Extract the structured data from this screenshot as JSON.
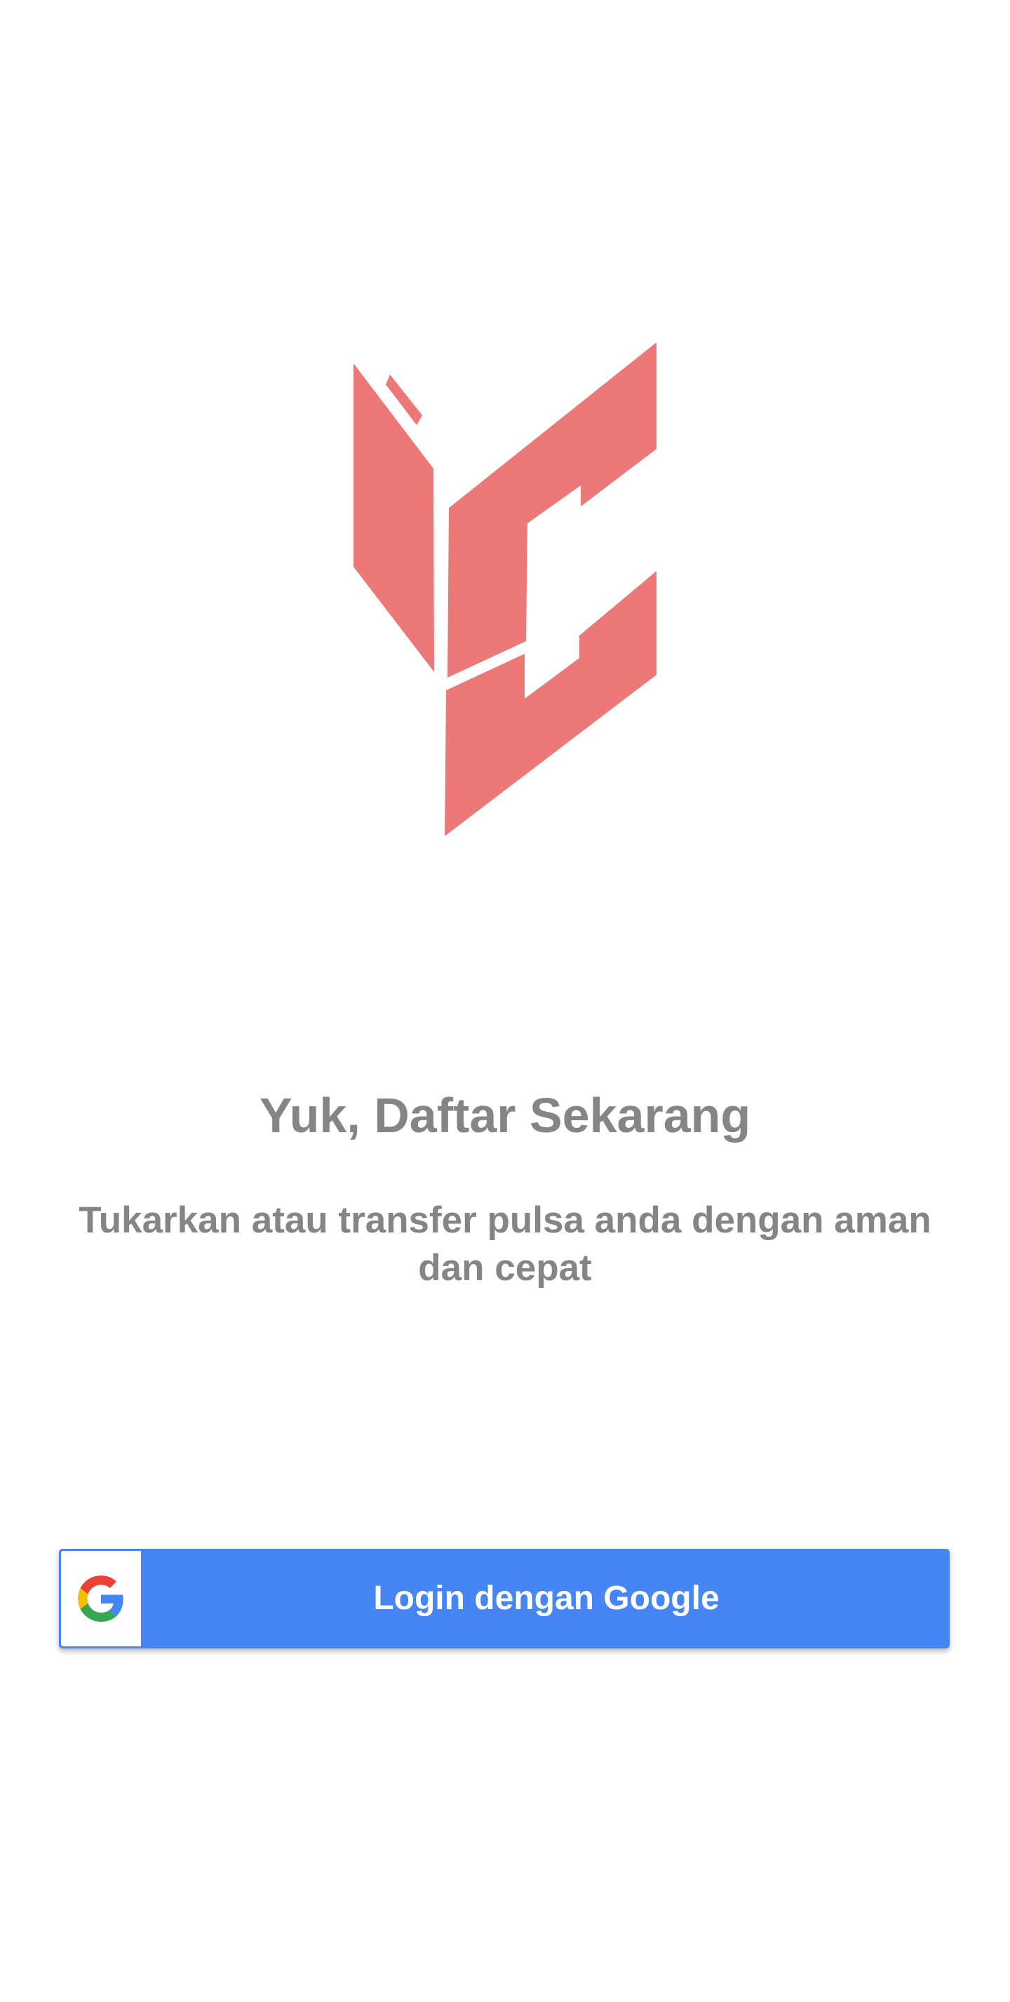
{
  "colors": {
    "background": "#ffffff",
    "logo": "#EC7878",
    "text": "#858585",
    "google_button": "#4586F4",
    "google_button_text": "#ffffff"
  },
  "logo": {
    "icon": "brand-logo-icon"
  },
  "signup": {
    "title": "Yuk, Daftar Sekarang",
    "subtitle": "Tukarkan atau transfer pulsa anda dengan aman dan cepat"
  },
  "google_button": {
    "icon": "google-icon",
    "label": "Login dengan Google"
  }
}
